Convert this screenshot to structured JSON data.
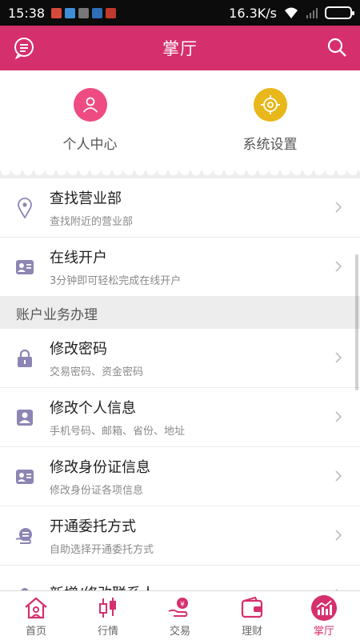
{
  "status": {
    "time": "15:38",
    "net_speed": "16.3K/s"
  },
  "header": {
    "title": "掌厅"
  },
  "quick": [
    {
      "label": "个人中心",
      "color": "#ee4b83"
    },
    {
      "label": "系统设置",
      "color": "#e8b71a"
    }
  ],
  "top_items": [
    {
      "title": "查找营业部",
      "subtitle": "查找附近的营业部"
    },
    {
      "title": "在线开户",
      "subtitle": "3分钟即可轻松完成在线开户"
    }
  ],
  "section": {
    "title": "账户业务办理"
  },
  "account_items": [
    {
      "title": "修改密码",
      "subtitle": "交易密码、资金密码"
    },
    {
      "title": "修改个人信息",
      "subtitle": "手机号码、邮箱、省份、地址"
    },
    {
      "title": "修改身份证信息",
      "subtitle": "修改身份证各项信息"
    },
    {
      "title": "开通委托方式",
      "subtitle": "自助选择开通委托方式"
    },
    {
      "title": "新增/修改联系人",
      "subtitle": ""
    }
  ],
  "tabs": [
    {
      "label": "首页"
    },
    {
      "label": "行情"
    },
    {
      "label": "交易"
    },
    {
      "label": "理财"
    },
    {
      "label": "掌厅"
    }
  ],
  "colors": {
    "brand": "#d62f6d",
    "icon_purple": "#8d85b4"
  }
}
